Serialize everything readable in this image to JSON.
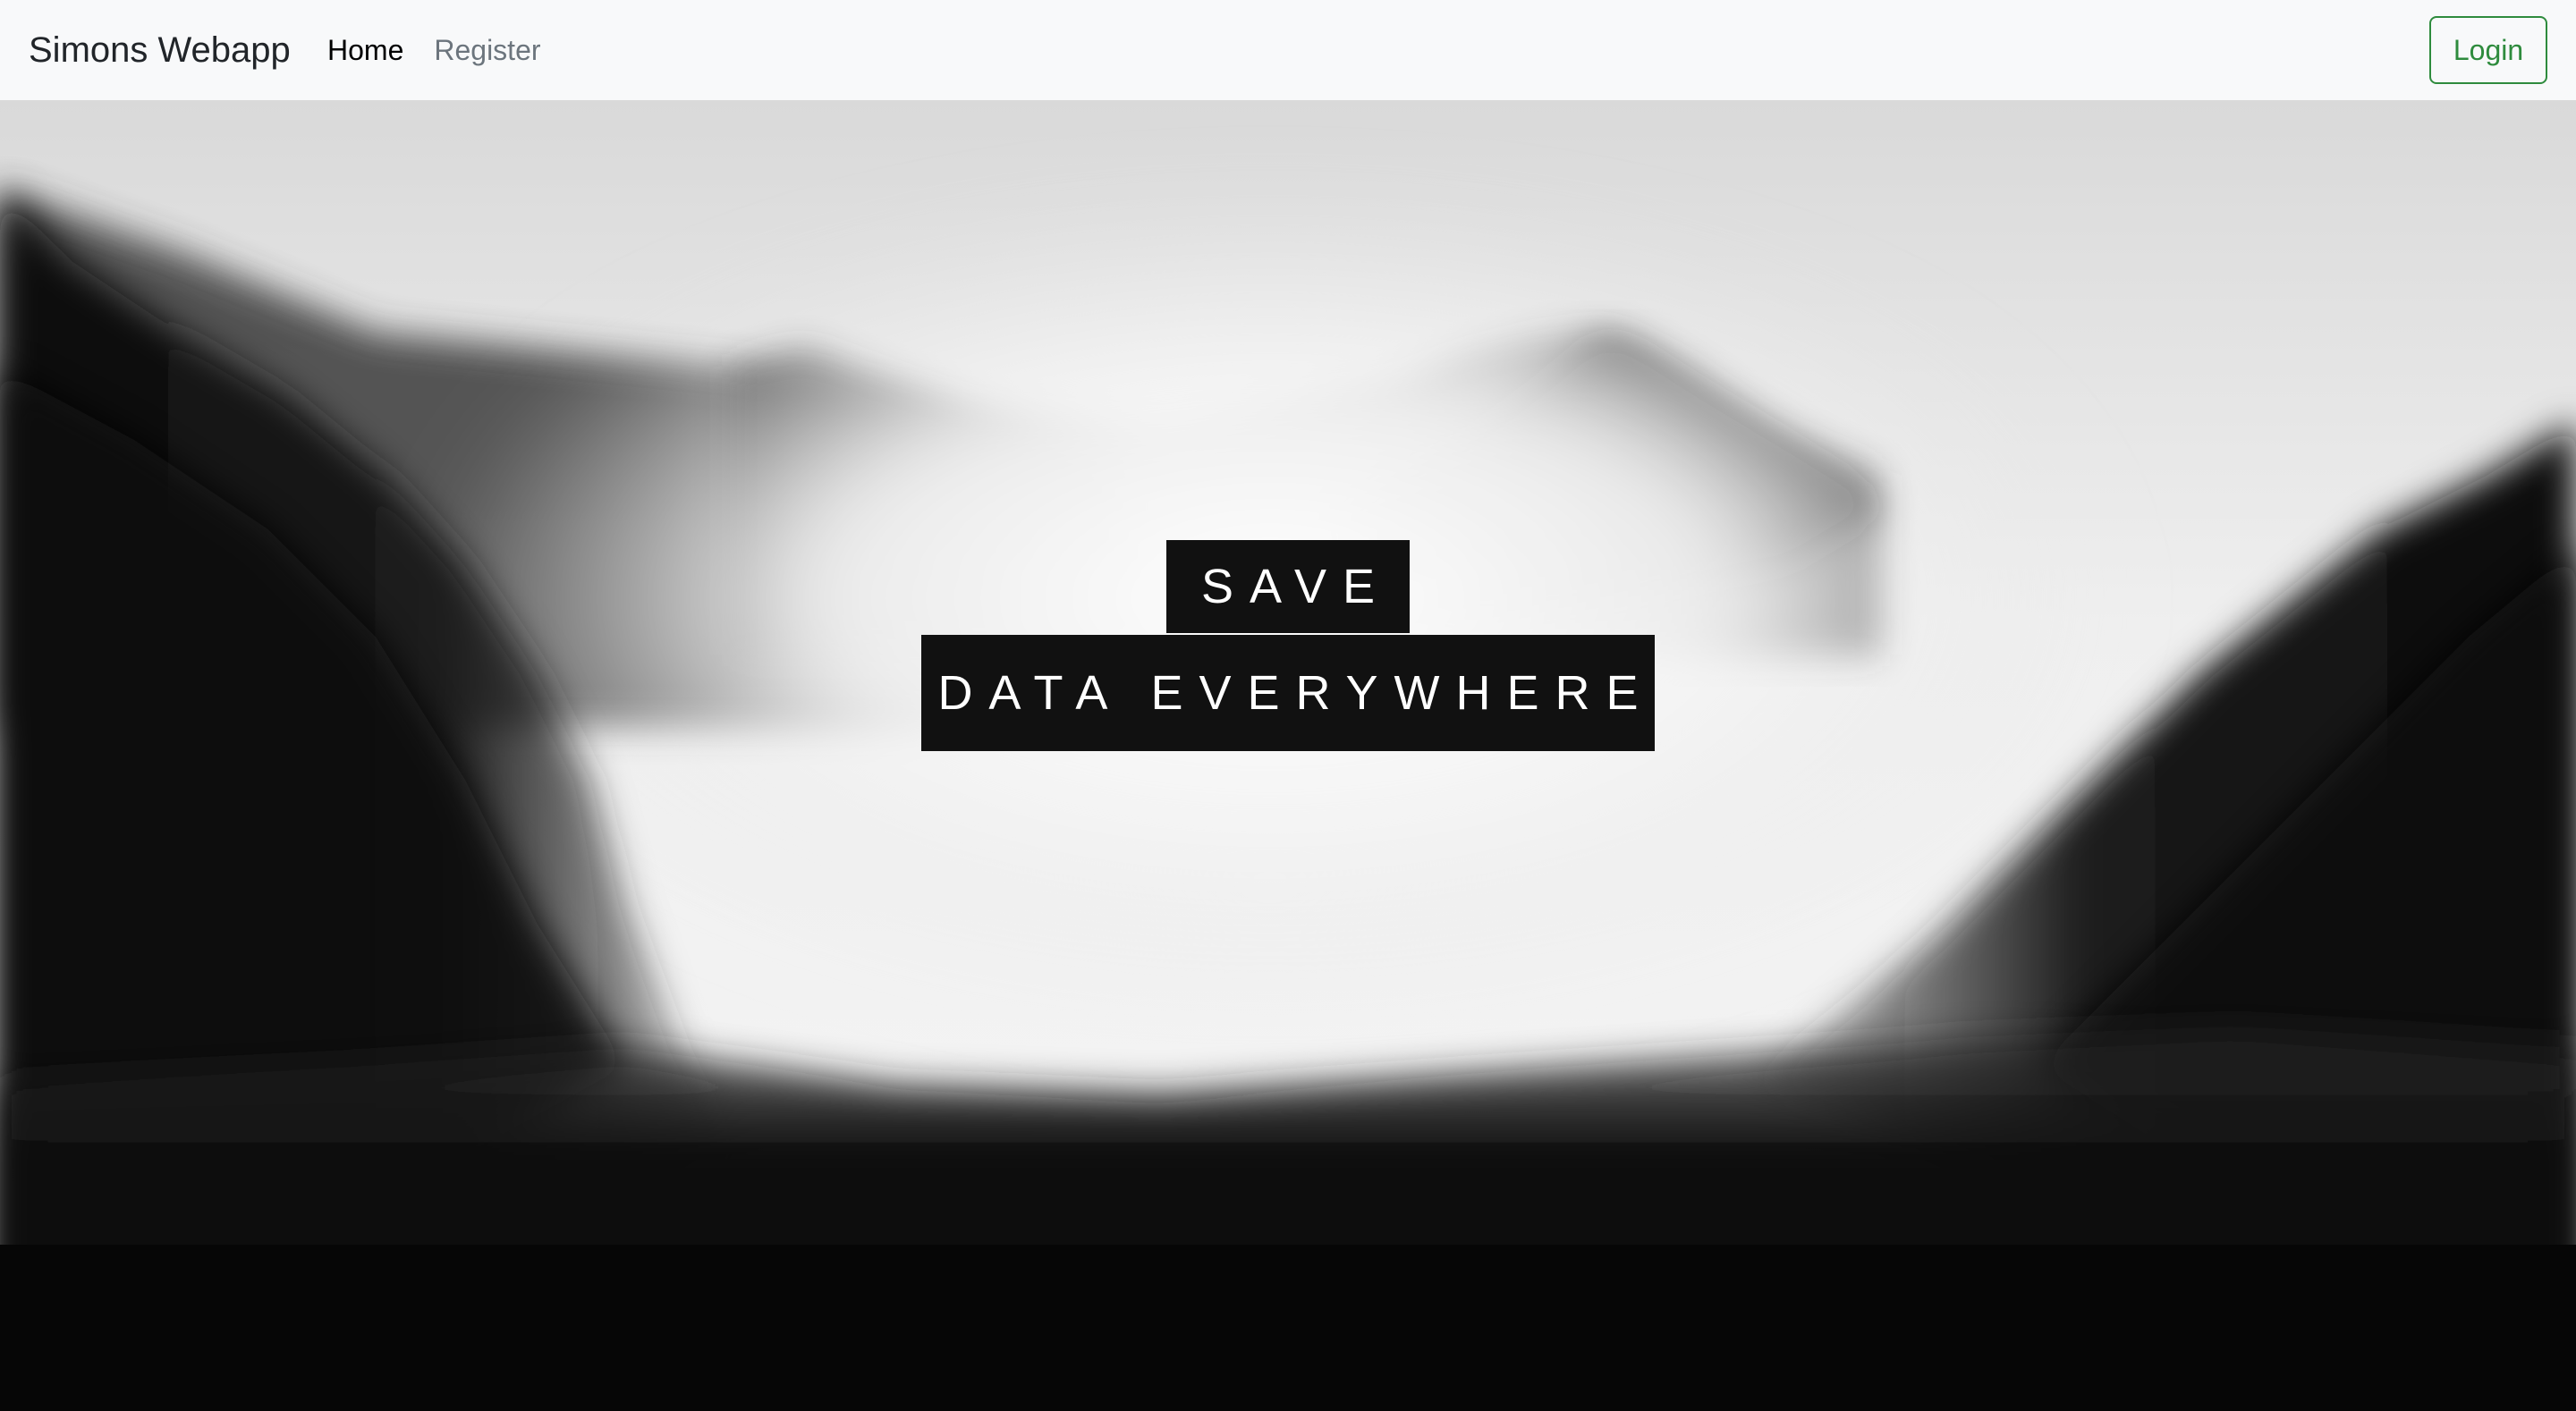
{
  "navbar": {
    "brand": "Simons Webapp",
    "links": [
      {
        "label": "Home",
        "active": true
      },
      {
        "label": "Register",
        "active": false
      }
    ],
    "login_label": "Login",
    "login_color": "#2e8b3d",
    "background": "#f8f9fa"
  },
  "hero": {
    "background": "misty forested mountain valley, black and white",
    "headline_line1": "SAVE",
    "headline_line2": "DATA EVERYWHERE",
    "tag_color": "#111111"
  }
}
